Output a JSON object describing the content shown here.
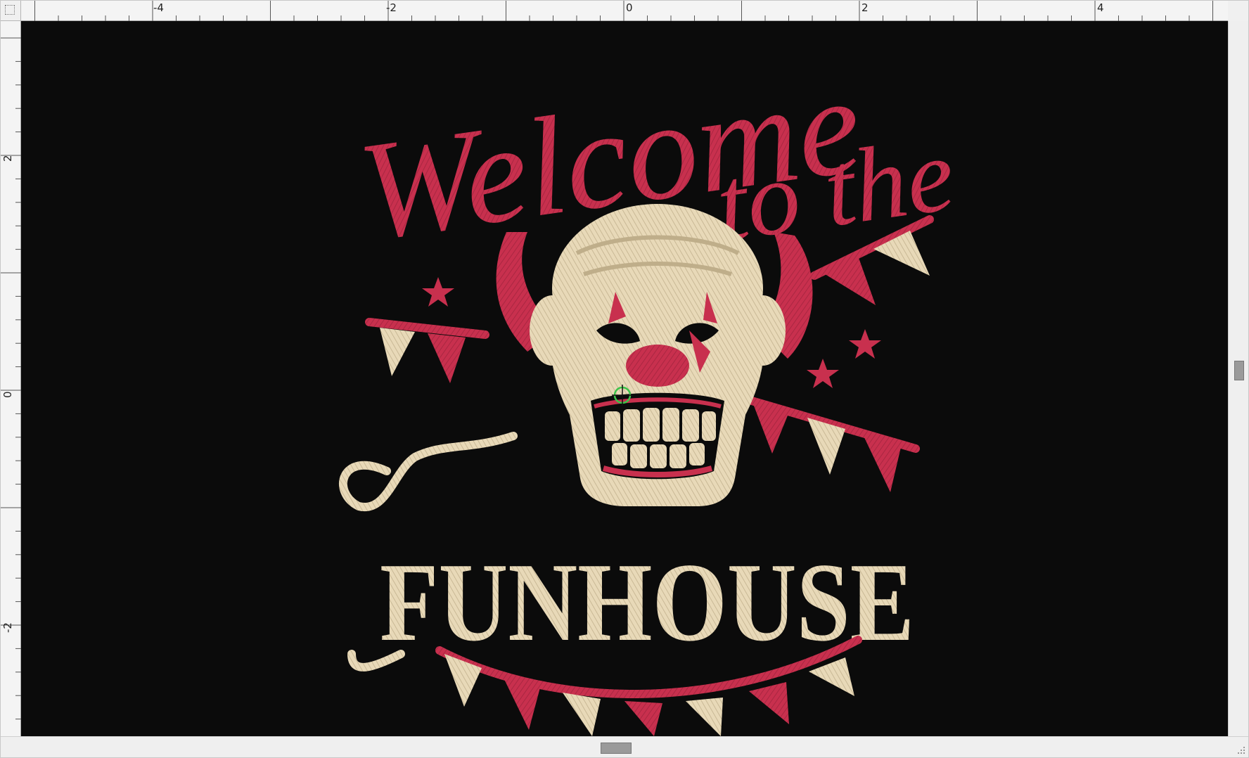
{
  "ruler": {
    "horizontal": [
      "-4",
      "-2",
      "0",
      "2",
      "4"
    ],
    "vertical": [
      "2",
      "0",
      "-2"
    ]
  },
  "design": {
    "line1": "Welcome",
    "line2": "to the",
    "line3": "FUNHOUSE",
    "colors": {
      "background": "#0b0b0b",
      "red": "#c8304e",
      "cream": "#e8d9b8",
      "ruler": "#f4f4f4"
    }
  }
}
